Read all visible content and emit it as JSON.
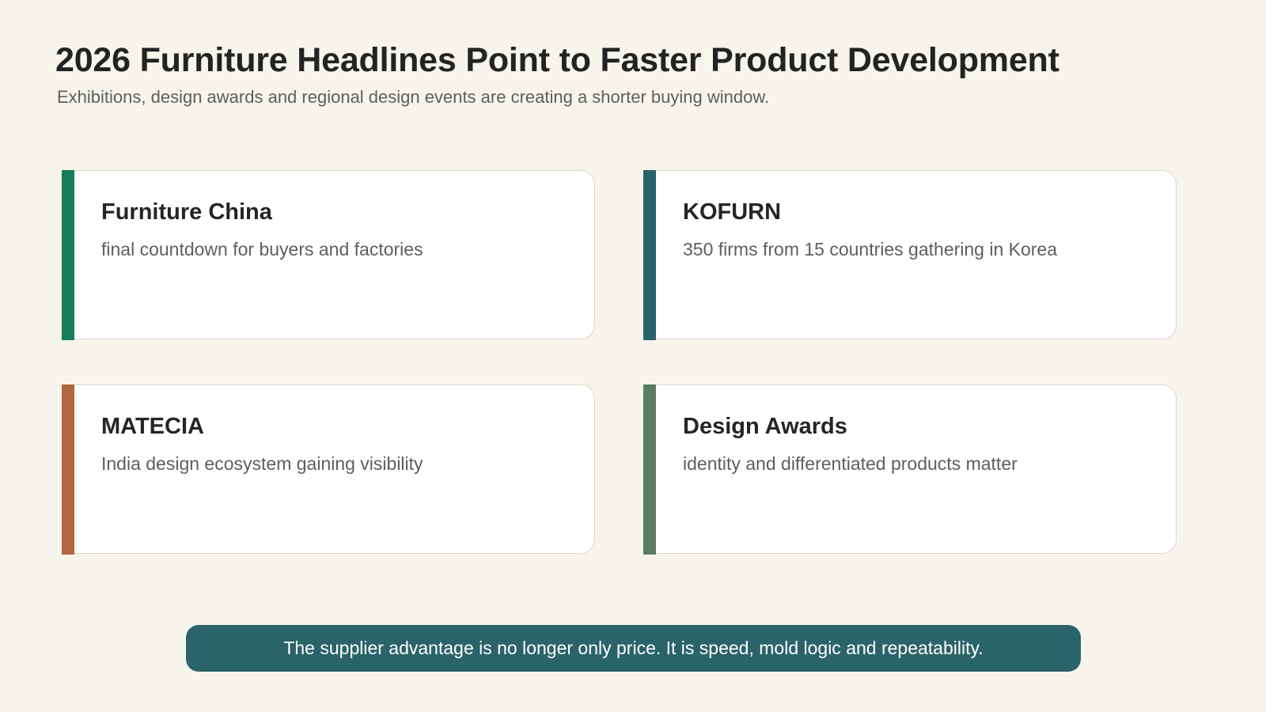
{
  "header": {
    "title": "2026 Furniture Headlines Point to Faster Product Development",
    "subtitle": "Exhibitions, design awards and regional design events are creating a shorter buying window."
  },
  "cards": [
    {
      "title": "Furniture China",
      "text": "final countdown for buyers and factories",
      "accent_color": "#157d5a"
    },
    {
      "title": "KOFURN",
      "text": "350 firms from 15 countries gathering in Korea",
      "accent_color": "#2b636a"
    },
    {
      "title": "MATECIA",
      "text": "India design ecosystem gaining visibility",
      "accent_color": "#b06640"
    },
    {
      "title": "Design Awards",
      "text": "identity and differentiated products matter",
      "accent_color": "#5a7d62"
    }
  ],
  "banner": {
    "text": "The supplier advantage is no longer only price. It is speed, mold logic and repeatability.",
    "background_color": "#2b636a"
  }
}
